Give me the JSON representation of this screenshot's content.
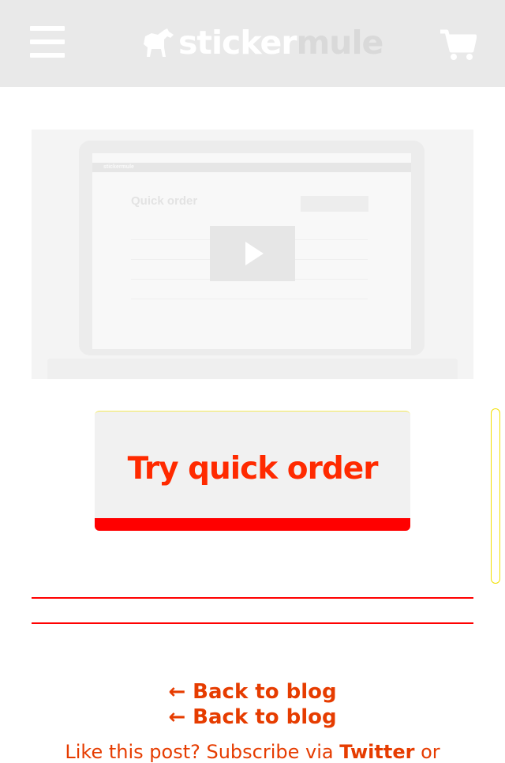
{
  "header": {
    "logo_primary": "sticker",
    "logo_secondary": "mule",
    "menu_icon": "hamburger-menu-icon",
    "cart_icon": "shopping-cart-icon"
  },
  "video": {
    "screen_title": "Quick order",
    "screen_logo": "stickermule",
    "play_icon": "play-icon"
  },
  "cta": {
    "label": "Try quick order"
  },
  "footer": {
    "back_link_1": "← Back to blog",
    "back_link_2": "← Back to blog",
    "subscribe_text": "Like this post? Subscribe via ",
    "twitter_link": "Twitter",
    "subscribe_suffix": " or"
  },
  "colors": {
    "accent": "#ff0000",
    "link": "#e63c00",
    "header_bg": "#e9e9e9"
  }
}
